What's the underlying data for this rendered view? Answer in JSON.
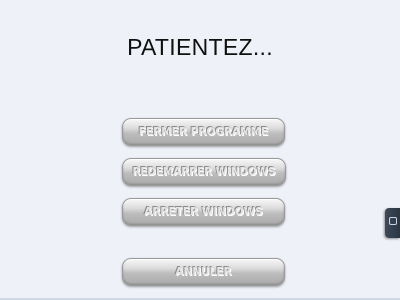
{
  "dialog": {
    "title": "PATIENTEZ..."
  },
  "buttons": {
    "close_program": "FERMER PROGRAMME",
    "restart_windows": "REDEMARRER WINDOWS",
    "shutdown_windows": "ARRETER WINDOWS",
    "cancel": "ANNULER"
  },
  "side_tab": {
    "icon": "window-icon"
  },
  "colors": {
    "background": "#eef1f8",
    "button_gradient_top": "#f7f7f7",
    "button_gradient_bottom": "#a9a9a9",
    "side_tab": "#2b3542"
  }
}
